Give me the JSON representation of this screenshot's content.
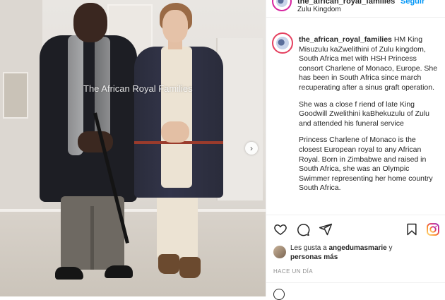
{
  "photo": {
    "watermark": "The African Royal Families",
    "next_icon": "chevron-right-icon",
    "next_glyph": "›"
  },
  "post": {
    "username": "the_african_royal_families",
    "follow_label": "Seguir",
    "location": "Zulu Kingdom",
    "caption": {
      "username": "the_african_royal_families",
      "paragraph_1": "HM King Misuzulu kaZwelithini of Zulu kingdom, South Africa met with HSH Princess consort Charlene of Monaco, Europe. She has been in South Africa since march recuperating after a sinus graft operation.",
      "paragraph_2": "She was a close f riend of late King Goodwill Zwelithini kaBhekuzulu of Zulu and attended his funeral service",
      "paragraph_3": "Princess Charlene of Monaco is the closest European royal to any African Royal. Born in Zimbabwe and raised in South Africa, she was an Olympic Swimmer representing her home country South Africa."
    },
    "actions": {
      "like_icon": "heart-icon",
      "comment_icon": "comment-icon",
      "share_icon": "send-icon",
      "save_icon": "bookmark-icon",
      "right_icon": "instagram-icon"
    },
    "likes": {
      "prefix": "Les gusta a ",
      "user": "angedumasmarie",
      "middle": " y",
      "others": "personas más"
    },
    "time_ago": "HACE UN DÍA"
  },
  "colors": {
    "accent": "#0095f6",
    "text": "#262626",
    "muted": "#8e8e8e",
    "border": "#efefef"
  }
}
